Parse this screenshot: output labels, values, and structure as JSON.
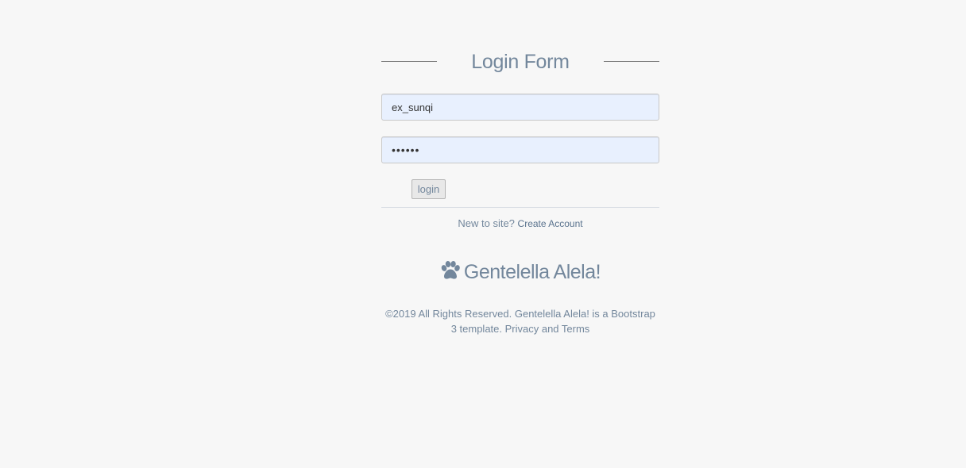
{
  "login_form": {
    "title": "Login Form",
    "username_value": "ex_sunqi",
    "password_value": "123456",
    "login_button_label": "login",
    "new_to_site_text": "New to site?",
    "create_account_label": "Create Account"
  },
  "brand": {
    "icon": "paw-icon",
    "name": "Gentelella Alela!"
  },
  "footer": {
    "copyright": "©2019 All Rights Reserved. Gentelella Alela! is a Bootstrap 3 template. Privacy and Terms"
  },
  "colors": {
    "text": "#73879c",
    "background": "#f7f7f7",
    "input_background": "#e8f0fe"
  }
}
